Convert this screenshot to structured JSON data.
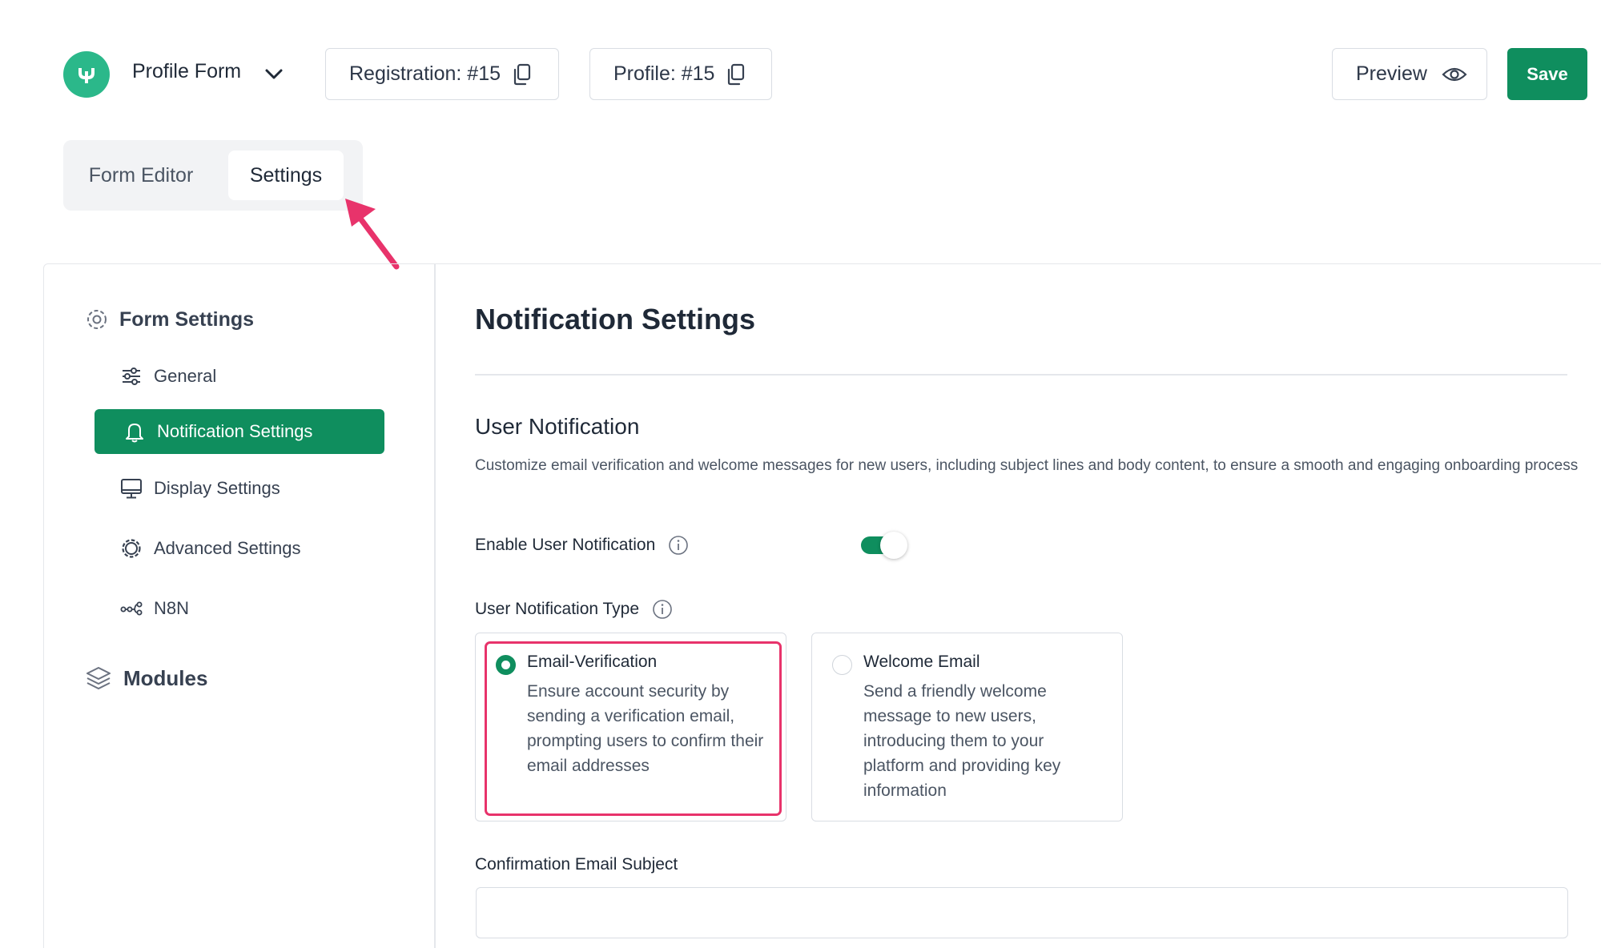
{
  "header": {
    "form_title": "Profile Form",
    "registration_label": "Registration: #15",
    "profile_label": "Profile: #15",
    "preview_label": "Preview",
    "save_label": "Save",
    "brand_color": "#0f8e5e",
    "logo_color": "#2bb88a"
  },
  "editor_tabs": [
    {
      "label": "Form Editor",
      "active": false
    },
    {
      "label": "Settings",
      "active": true
    }
  ],
  "annotation": {
    "arrow_color": "#e8336b",
    "highlight_color": "#e8336b"
  },
  "sidebar": {
    "form_settings_heading": "Form Settings",
    "items": [
      {
        "label": "General",
        "icon": "sliders-icon",
        "active": false
      },
      {
        "label": "Notification Settings",
        "icon": "bell-icon",
        "active": true
      },
      {
        "label": "Display Settings",
        "icon": "monitor-icon",
        "active": false
      },
      {
        "label": "Advanced Settings",
        "icon": "gear-icon",
        "active": false
      },
      {
        "label": "N8N",
        "icon": "workflow-icon",
        "active": false
      }
    ],
    "modules_heading": "Modules"
  },
  "content": {
    "page_title": "Notification Settings",
    "section_title": "User Notification",
    "section_description": "Customize email verification and welcome messages for new users, including subject lines and body content, to ensure a smooth and engaging onboarding process",
    "enable_label": "Enable User Notification",
    "enable_value": true,
    "type_label": "User Notification Type",
    "options": [
      {
        "title": "Email-Verification",
        "description": "Ensure account security by sending a verification email, prompting users to confirm their email addresses",
        "selected": true
      },
      {
        "title": "Welcome Email",
        "description": "Send a friendly welcome message to new users, introducing them to your platform and providing key information",
        "selected": false
      }
    ],
    "subject_label": "Confirmation Email Subject",
    "subject_value": ""
  }
}
